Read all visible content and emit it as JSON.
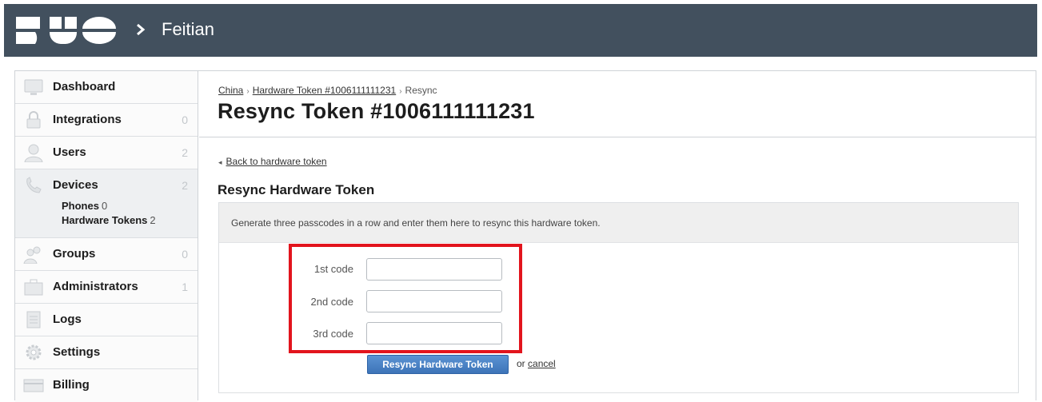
{
  "header": {
    "logo": "DUO",
    "org_name": "Feitian"
  },
  "sidebar": {
    "items": [
      {
        "label": "Dashboard",
        "count": "",
        "icon": "monitor-icon"
      },
      {
        "label": "Integrations",
        "count": "0",
        "icon": "lock-icon"
      },
      {
        "label": "Users",
        "count": "2",
        "icon": "user-icon"
      },
      {
        "label": "Devices",
        "count": "2",
        "icon": "phone-icon",
        "subitems": [
          {
            "label": "Phones",
            "count": "0"
          },
          {
            "label": "Hardware Tokens",
            "count": "2"
          }
        ]
      },
      {
        "label": "Groups",
        "count": "0",
        "icon": "group-icon"
      },
      {
        "label": "Administrators",
        "count": "1",
        "icon": "briefcase-icon"
      },
      {
        "label": "Logs",
        "count": "",
        "icon": "log-icon"
      },
      {
        "label": "Settings",
        "count": "",
        "icon": "gear-icon"
      },
      {
        "label": "Billing",
        "count": "",
        "icon": "billing-icon"
      }
    ]
  },
  "breadcrumb": {
    "items": [
      "China",
      "Hardware Token #1006111111231",
      "Resync"
    ]
  },
  "page": {
    "title": "Resync Token #1006111111231",
    "back_link": "Back to hardware token",
    "section_title": "Resync Hardware Token",
    "instructions": "Generate three passcodes in a row and enter them here to resync this hardware token."
  },
  "form": {
    "fields": [
      {
        "label": "1st code",
        "value": ""
      },
      {
        "label": "2nd code",
        "value": ""
      },
      {
        "label": "3rd code",
        "value": ""
      }
    ],
    "submit_label": "Resync Hardware Token",
    "or_text": "or",
    "cancel_label": "cancel"
  },
  "colors": {
    "header_bg": "#42505e",
    "highlight": "#e2141d",
    "button": "#3d74b8"
  }
}
